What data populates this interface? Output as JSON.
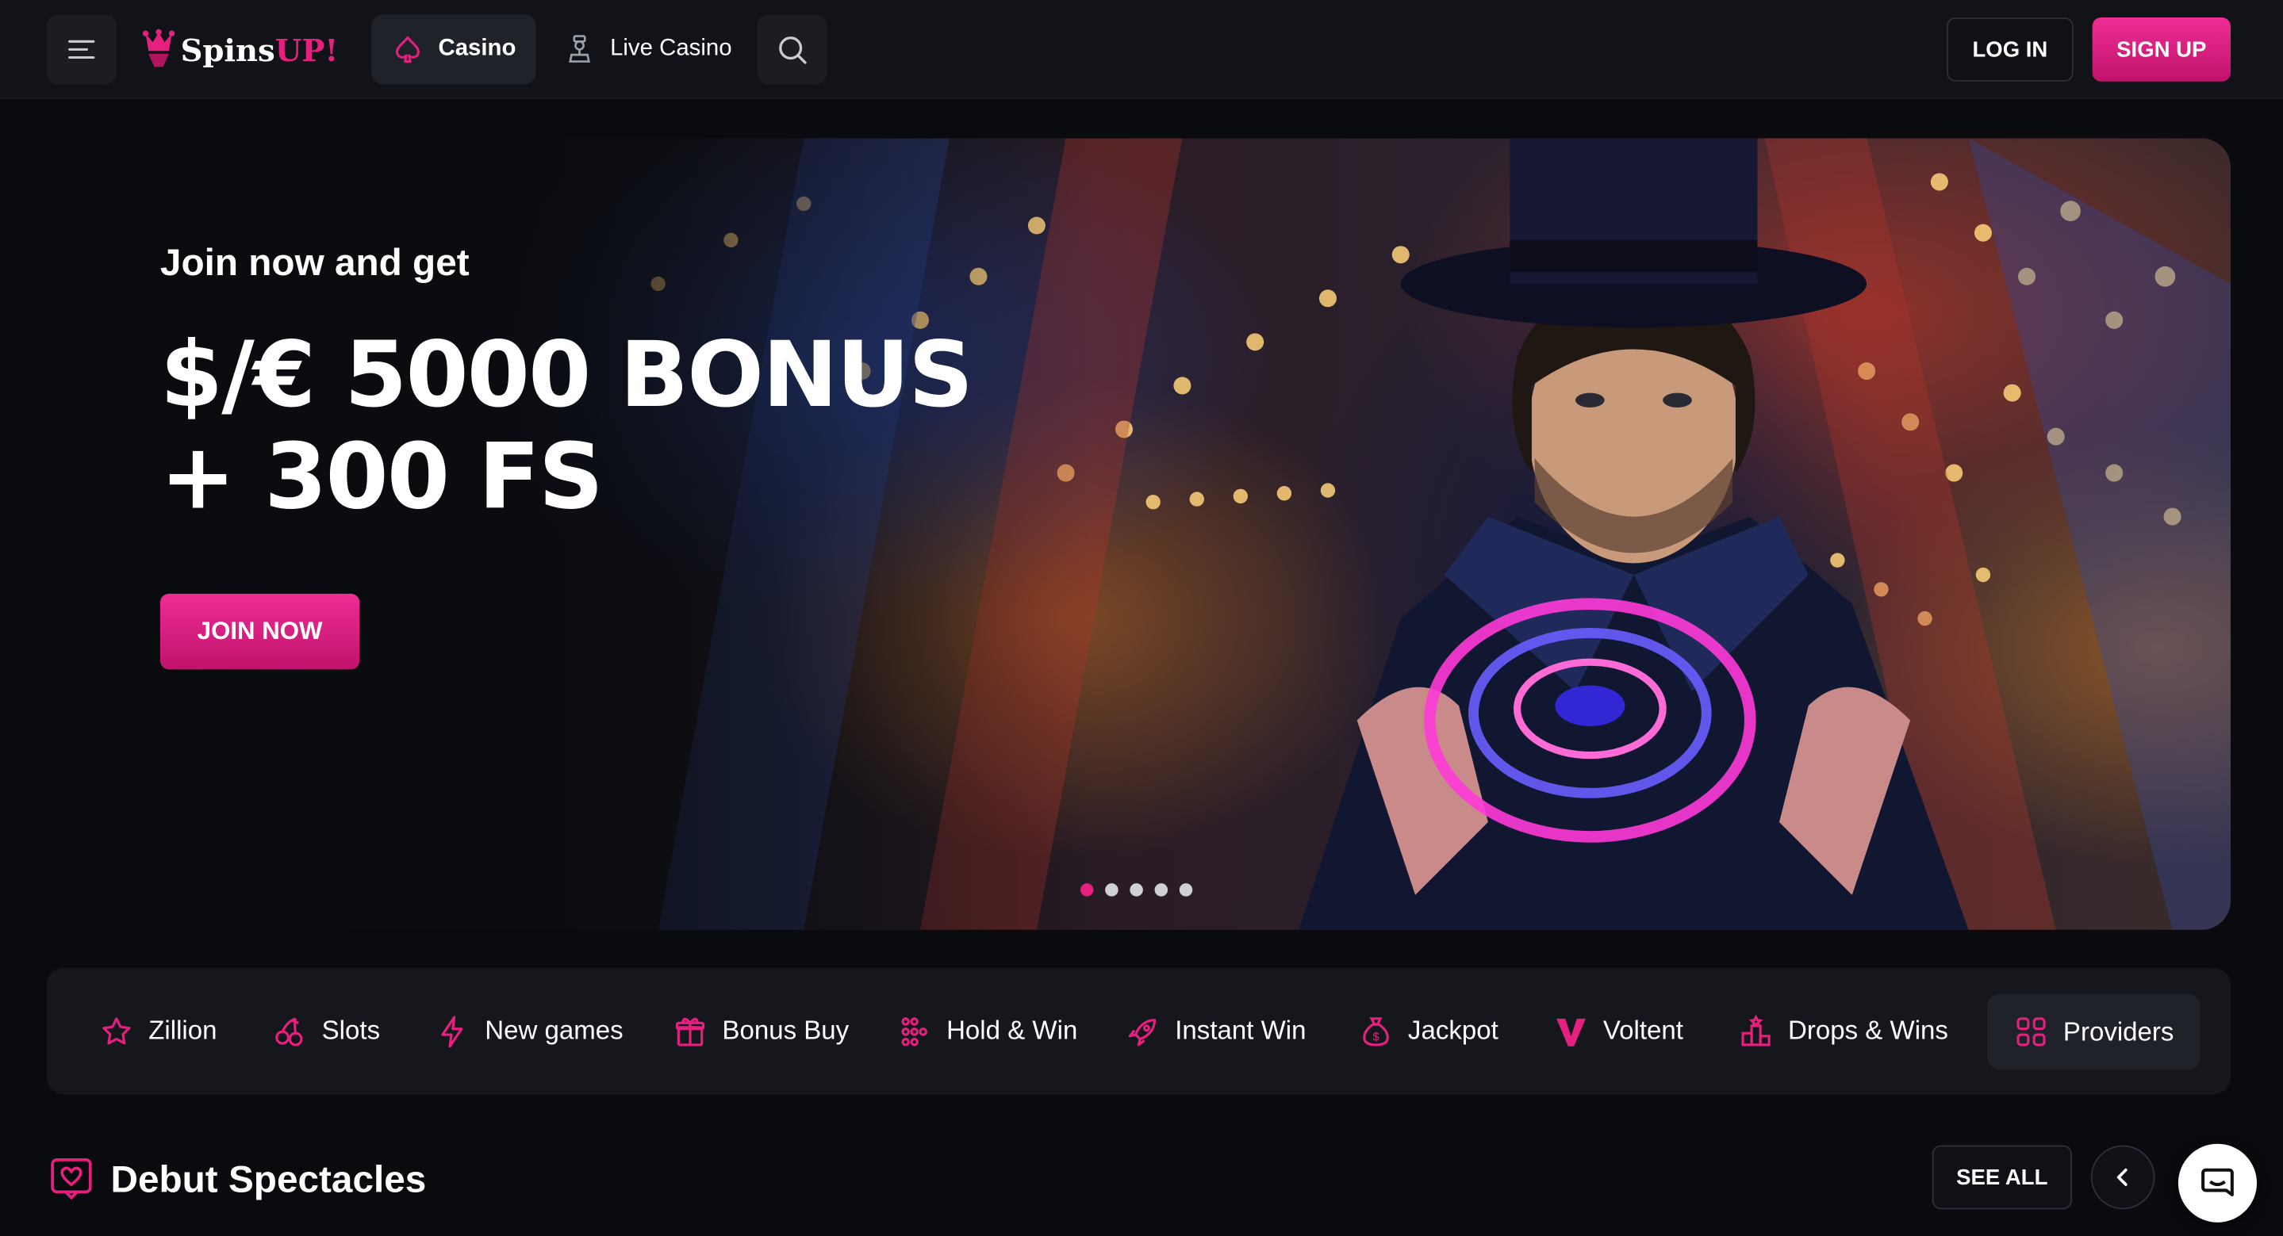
{
  "brand": {
    "logo_part1": "Spins",
    "logo_part2": "UP!",
    "accent_color": "#e5207e"
  },
  "header": {
    "menu_icon": "hamburger-icon",
    "tabs": [
      {
        "label": "Casino",
        "icon": "spade-icon",
        "active": true
      },
      {
        "label": "Live Casino",
        "icon": "dealer-icon",
        "active": false
      }
    ],
    "search_icon": "search-icon",
    "login_label": "LOG IN",
    "signup_label": "SIGN UP"
  },
  "hero": {
    "kicker": "Join now and get",
    "headline_line1": "$/€ 5000 BONUS",
    "headline_line2": "+ 300 FS",
    "cta_label": "JOIN NOW",
    "slide_count": 5,
    "active_slide": 1
  },
  "categories": [
    {
      "label": "Zillion",
      "icon": "star-icon"
    },
    {
      "label": "Slots",
      "icon": "cherry-icon"
    },
    {
      "label": "New games",
      "icon": "lightning-icon"
    },
    {
      "label": "Bonus Buy",
      "icon": "gift-icon"
    },
    {
      "label": "Hold & Win",
      "icon": "grid-dots-icon"
    },
    {
      "label": "Instant Win",
      "icon": "rocket-icon"
    },
    {
      "label": "Jackpot",
      "icon": "money-bag-icon"
    },
    {
      "label": "Voltent",
      "icon": "voltent-logo-icon"
    },
    {
      "label": "Drops & Wins",
      "icon": "podium-icon"
    },
    {
      "label": "Providers",
      "icon": "four-squares-icon"
    }
  ],
  "section": {
    "title": "Debut Spectacles",
    "icon": "heart-frame-icon",
    "see_all_label": "SEE ALL",
    "prev_icon": "chevron-left-icon",
    "next_icon": "chevron-right-icon"
  },
  "chat": {
    "icon": "chat-icon"
  }
}
